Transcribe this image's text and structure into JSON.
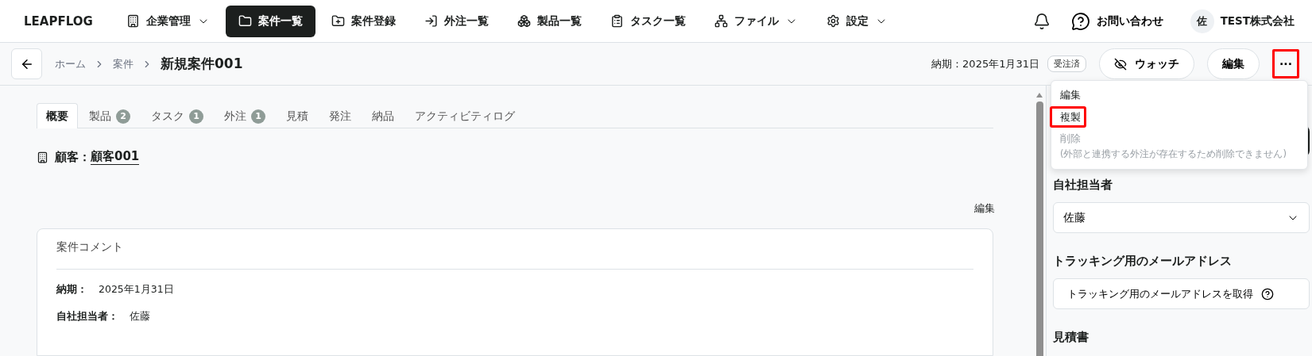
{
  "nav": {
    "logo": "LEAPFLOG",
    "items": [
      {
        "label": "企業管理",
        "dropdown": true,
        "selected": false
      },
      {
        "label": "案件一覧",
        "dropdown": false,
        "selected": true
      },
      {
        "label": "案件登録",
        "dropdown": false,
        "selected": false
      },
      {
        "label": "外注一覧",
        "dropdown": false,
        "selected": false
      },
      {
        "label": "製品一覧",
        "dropdown": false,
        "selected": false
      },
      {
        "label": "タスク一覧",
        "dropdown": false,
        "selected": false
      },
      {
        "label": "ファイル",
        "dropdown": true,
        "selected": false
      },
      {
        "label": "設定",
        "dropdown": true,
        "selected": false
      }
    ],
    "contact": "お問い合わせ",
    "avatar": "佐",
    "company": "TEST株式会社"
  },
  "header": {
    "breadcrumbs": [
      "ホーム",
      "案件"
    ],
    "title": "新規案件001",
    "due": "納期：2025年1月31日",
    "status": "受注済",
    "watch": "ウォッチ",
    "edit": "編集",
    "more": {
      "label": "···",
      "highlighted": true
    }
  },
  "tabs": [
    {
      "label": "概要",
      "selected": true
    },
    {
      "label": "製品",
      "count": "2",
      "selected": false
    },
    {
      "label": "タスク",
      "count": "1",
      "selected": false
    },
    {
      "label": "外注",
      "count": "1",
      "selected": false
    },
    {
      "label": "見積",
      "selected": false
    },
    {
      "label": "発注",
      "selected": false
    },
    {
      "label": "納品",
      "selected": false
    },
    {
      "label": "アクティビティログ",
      "selected": false
    }
  ],
  "customer": {
    "label": "顧客：",
    "name": "顧客001"
  },
  "edit_link": "編集",
  "comment_card": {
    "title": "案件コメント",
    "fields": [
      {
        "label": "納期：",
        "value": "2025年1月31日"
      },
      {
        "label": "自社担当者：",
        "value": "佐藤"
      }
    ]
  },
  "menu": [
    {
      "label": "編集",
      "disabled": false,
      "highlighted": false
    },
    {
      "label": "複製",
      "disabled": false,
      "highlighted": true
    },
    {
      "label": "削除",
      "note": "(外部と連携する外注が存在するため削除できません)",
      "disabled": true,
      "highlighted": false
    }
  ],
  "side": {
    "staff_heading": "自社担当者",
    "staff_value": "佐藤",
    "tracking_heading": "トラッキング用のメールアドレス",
    "tracking_button": "トラッキング用のメールアドレスを取得",
    "quote_heading": "見積書"
  }
}
